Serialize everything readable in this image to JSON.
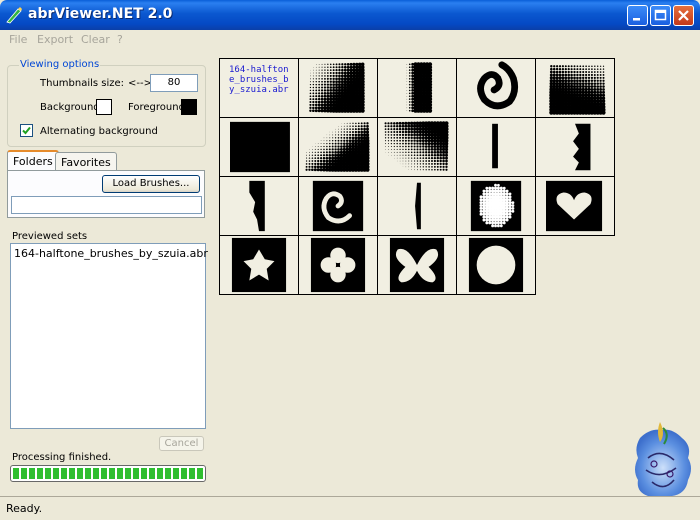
{
  "window": {
    "title": "abrViewer.NET 2.0"
  },
  "menu": [
    "File",
    "Export",
    "Clear",
    "?"
  ],
  "viewing_options": {
    "legend": "Viewing options",
    "thumb_size_label": "Thumbnails size:",
    "thumb_size_arrow": "<-->",
    "thumb_size_value": "80",
    "background_label": "Background:",
    "background_color": "#ffffff",
    "foreground_label": "Foreground:",
    "foreground_color": "#000000",
    "alternating_label": "Alternating background",
    "alternating_checked": true
  },
  "tabs": [
    "Folders",
    "Favorites"
  ],
  "folders": {
    "load_button": "Load Brushes...",
    "path_value": ""
  },
  "previewed": {
    "label": "Previewed sets",
    "items": [
      "164-halftone_brushes_by_szuia.abr"
    ]
  },
  "cancel_label": "Cancel",
  "processing_text": "Processing finished.",
  "progress_fraction": 1.0,
  "set_name": "164-halftone_brushes_by_szuia.abr",
  "brushes": [
    "halftone-gradient",
    "halftone-strip",
    "halftone-swirl",
    "halftone-dots-light",
    "halftone-dots-dark",
    "halftone-dots-diagonal",
    "halftone-dots-corner",
    "halftone-line",
    "halftone-jagged-strip",
    "halftone-edge",
    "halftone-swirl-dark",
    "halftone-thin-line",
    "halftone-blob",
    "halftone-heart",
    "halftone-star",
    "halftone-flower",
    "halftone-butterfly",
    "halftone-circle"
  ],
  "status": "Ready."
}
